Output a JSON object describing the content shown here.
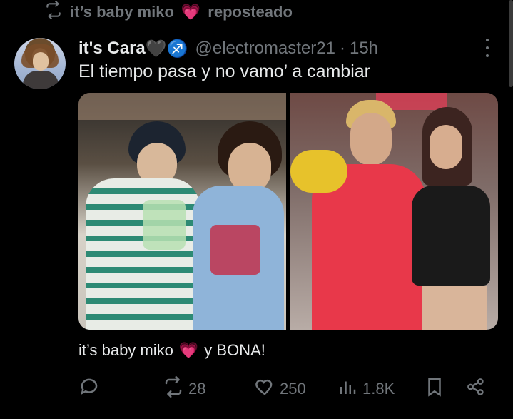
{
  "repost": {
    "name": "it’s baby miko",
    "emoji": "💗",
    "suffix": "reposteado"
  },
  "author": {
    "display_name": "it's Cara",
    "emoji": "🖤♐",
    "handle": "@electromaster21",
    "separator": "·",
    "time": "15h"
  },
  "tweet": {
    "text": "El tiempo pasa y no vamo’ a cambiar"
  },
  "caption": {
    "text": "it’s baby miko",
    "emoji": "💗",
    "suffix": "y BONA!"
  },
  "actions": {
    "reposts": "28",
    "likes": "250",
    "views": "1.8K"
  },
  "colors": {
    "text": "#e7e9ea",
    "muted": "#71767b",
    "background": "#000000"
  }
}
